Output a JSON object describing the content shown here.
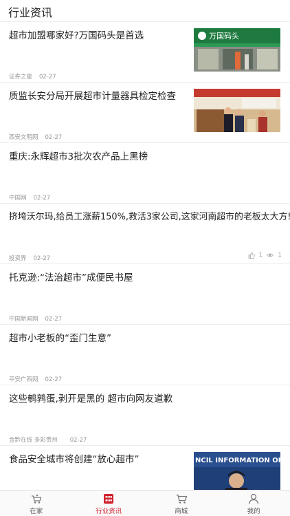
{
  "header": {
    "title": "行业资讯"
  },
  "articles": [
    {
      "headline": "超市加盟哪家好?万国码头是首选",
      "source": "证券之星",
      "date": "02-27"
    },
    {
      "headline": "质监长安分局开展超市计量器具检定检查",
      "source": "西安文明网",
      "date": "02-27"
    },
    {
      "headline": "重庆:永辉超市3批次农产品上黑榜",
      "source": "中国网",
      "date": "02-27"
    },
    {
      "headline": "挤垮沃尔玛,给员工涨薪150%,救活3家公司,这家河南超市的老板太大方!",
      "source": "投资界",
      "date": "02-27",
      "likes": "1",
      "views": "1"
    },
    {
      "headline": "托克逊:“法治超市”成便民书屋",
      "source": "中国新闻网",
      "date": "02-27"
    },
    {
      "headline": "超市小老板的“歪门生意”",
      "source": "平安广西网",
      "date": "02-27"
    },
    {
      "headline": "这些鹌鹑蛋,剥开是黑的 超市向网友道歉",
      "source": "金黔在线 多彩贵州",
      "date": "02-27"
    },
    {
      "headline": "食品安全城市将创建“放心超市”",
      "source": "",
      "date": ""
    }
  ],
  "thumbs": {
    "store_sign": "万国码头",
    "conference_sign": "NCIL INFORMATION OFFI"
  },
  "tabs": [
    {
      "label": "在家",
      "icon": "cart-basket-icon",
      "active": false
    },
    {
      "label": "行业资讯",
      "icon": "news-grid-icon",
      "active": true
    },
    {
      "label": "商城",
      "icon": "shopping-cart-icon",
      "active": false
    },
    {
      "label": "我的",
      "icon": "person-icon",
      "active": false
    }
  ],
  "colors": {
    "accent": "#d0202e",
    "divider": "#ececec",
    "meta_text": "#999999"
  }
}
